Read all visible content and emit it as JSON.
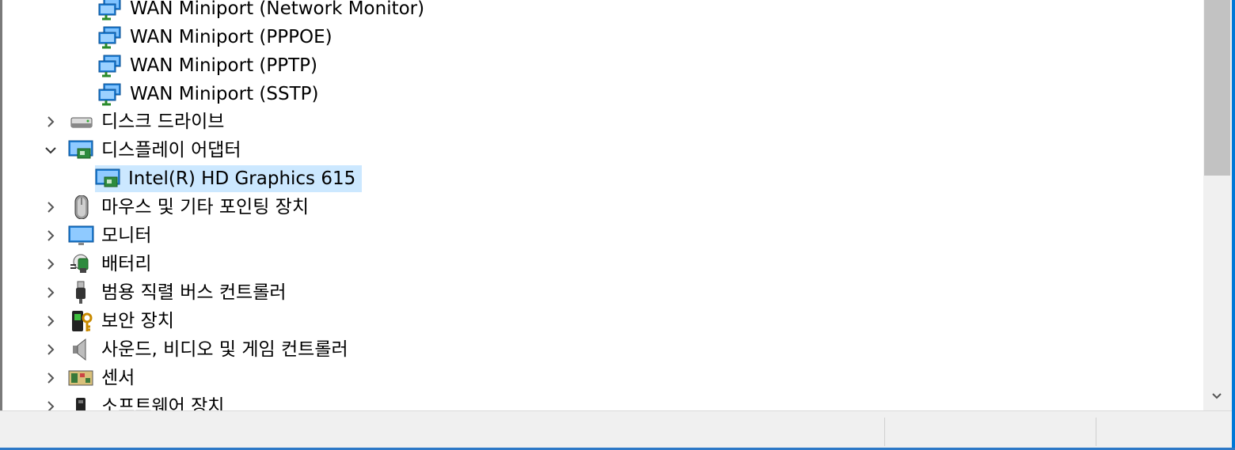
{
  "tree": {
    "items": [
      {
        "label": "WAN Miniport (Network Monitor)",
        "icon": "network-adapter-icon",
        "expander": "none"
      },
      {
        "label": "WAN Miniport (PPPOE)",
        "icon": "network-adapter-icon",
        "expander": "none"
      },
      {
        "label": "WAN Miniport (PPTP)",
        "icon": "network-adapter-icon",
        "expander": "none"
      },
      {
        "label": "WAN Miniport (SSTP)",
        "icon": "network-adapter-icon",
        "expander": "none"
      },
      {
        "label": "디스크 드라이브",
        "icon": "disk-drive-icon",
        "expander": "collapsed"
      },
      {
        "label": "디스플레이 어댑터",
        "icon": "display-adapter-icon",
        "expander": "expanded"
      },
      {
        "label": "Intel(R) HD Graphics 615",
        "icon": "display-adapter-icon",
        "expander": "none",
        "selected": true
      },
      {
        "label": "마우스 및 기타 포인팅 장치",
        "icon": "mouse-icon",
        "expander": "collapsed"
      },
      {
        "label": "모니터",
        "icon": "monitor-icon",
        "expander": "collapsed"
      },
      {
        "label": "배터리",
        "icon": "battery-icon",
        "expander": "collapsed"
      },
      {
        "label": "범용 직렬 버스 컨트롤러",
        "icon": "usb-icon",
        "expander": "collapsed"
      },
      {
        "label": "보안 장치",
        "icon": "security-device-icon",
        "expander": "collapsed"
      },
      {
        "label": "사운드, 비디오 및 게임 컨트롤러",
        "icon": "speaker-icon",
        "expander": "collapsed"
      },
      {
        "label": "센서",
        "icon": "sensor-icon",
        "expander": "collapsed"
      },
      {
        "label": "소프트웨어 장치",
        "icon": "software-device-icon",
        "expander": "collapsed"
      }
    ]
  },
  "colors": {
    "selection": "#cce8ff",
    "accent": "#0078d7"
  }
}
